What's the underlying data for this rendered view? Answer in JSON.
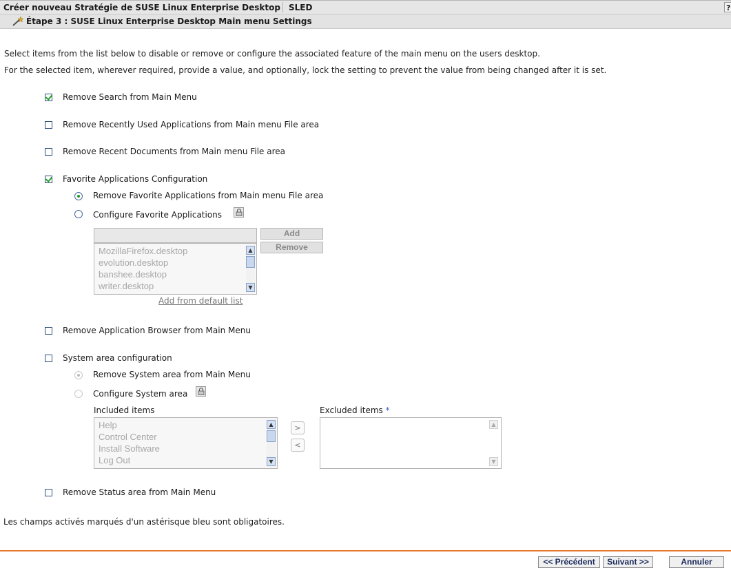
{
  "header": {
    "title": "Créer nouveau Stratégie de SUSE Linux Enterprise Desktop",
    "platform": "SLED",
    "help_label": "?",
    "step": "Étape 3 : SUSE Linux Enterprise Desktop Main menu Settings"
  },
  "description": {
    "line1": "Select items from the list below to disable or remove or configure the associated feature of the main menu on the users desktop.",
    "line2": "For the selected item, wherever required, provide a value, and optionally, lock the setting to prevent the value from being changed after it is set."
  },
  "options": {
    "remove_search": {
      "label": "Remove Search from Main Menu",
      "checked": true
    },
    "remove_recent_apps": {
      "label": "Remove Recently Used Applications from Main menu File area",
      "checked": false
    },
    "remove_recent_docs": {
      "label": "Remove Recent Documents from Main menu File area",
      "checked": false
    },
    "favorite_apps": {
      "label": "Favorite Applications Configuration",
      "checked": true,
      "radio_remove": "Remove Favorite Applications from Main menu File area",
      "radio_configure": "Configure Favorite Applications",
      "selected": "remove",
      "input_value": "",
      "add_label": "Add",
      "remove_label": "Remove",
      "items": [
        "MozillaFirefox.desktop",
        "evolution.desktop",
        "banshee.desktop",
        "writer.desktop"
      ],
      "add_default_link": "Add from default list"
    },
    "remove_app_browser": {
      "label": "Remove Application Browser from Main Menu",
      "checked": false
    },
    "system_area": {
      "label": "System area configuration",
      "checked": false,
      "radio_remove": "Remove System area from Main Menu",
      "radio_configure": "Configure System area",
      "selected": "remove",
      "included_label": "Included items",
      "excluded_label": "Excluded items",
      "required_mark": "*",
      "included_items": [
        "Help",
        "Control Center",
        "Install Software",
        "Log Out"
      ],
      "move_right": ">",
      "move_left": "<"
    },
    "remove_status": {
      "label": "Remove Status area from Main Menu",
      "checked": false
    }
  },
  "footer": {
    "required_note": "Les champs activés marqués d'un astérisque bleu sont obligatoires.",
    "prev_label": "<< Précédent",
    "next_label": "Suivant >>",
    "cancel_label": "Annuler"
  },
  "colors": {
    "accent_orange": "#e8752a",
    "check_green": "#21a121",
    "required_blue": "#3a62c8"
  }
}
